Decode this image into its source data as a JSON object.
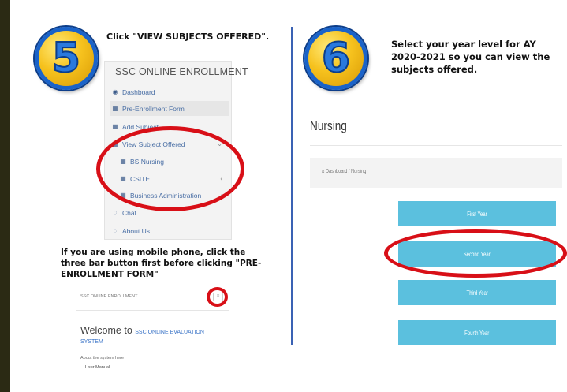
{
  "step5": {
    "number": "5",
    "instruction": "Click \"VIEW SUBJECTS OFFERED\"."
  },
  "left_panel": {
    "title": "SSC ONLINE ENROLLMENT",
    "menu": [
      {
        "label": "Dashboard",
        "icon": "dashboard-icon"
      },
      {
        "label": "Pre-Enrollment Form",
        "icon": "table-icon"
      },
      {
        "label": "Add Subject",
        "icon": "table-icon"
      },
      {
        "label": "View Subject Offered",
        "icon": "table-icon"
      },
      {
        "label": "BS Nursing",
        "icon": "table-icon"
      },
      {
        "label": "CSITE",
        "icon": "table-icon"
      },
      {
        "label": "Business Administration",
        "icon": "table-icon"
      },
      {
        "label": "Chat",
        "icon": "chat-icon"
      },
      {
        "label": "About Us",
        "icon": "chat-icon"
      }
    ]
  },
  "mobile_note": "If you are using mobile phone, click the three bar button first before clicking \"PRE-ENROLLMENT FORM\"",
  "mobile_view": {
    "header_title": "SSC ONLINE ENROLLMENT",
    "bar_button": "≡",
    "welcome_prefix": "Welcome to",
    "welcome_system": "SSC ONLINE EVALUATION",
    "welcome_system2": "SYSTEM",
    "about": "About the system here",
    "manual": "User Manual"
  },
  "step6": {
    "number": "6",
    "instruction": "Select your year level for AY 2020-2021 so you can view the subjects offered."
  },
  "right_panel": {
    "page_title": "Nursing",
    "breadcrumb_home": "Dashboard",
    "breadcrumb_current": "Nursing",
    "year_buttons": [
      "First Year",
      "Second Year",
      "Third Year",
      "Fourth Year"
    ]
  },
  "colors": {
    "highlight_oval": "#d80f17",
    "year_button": "#5bc0de",
    "divider": "#3a62b4"
  }
}
